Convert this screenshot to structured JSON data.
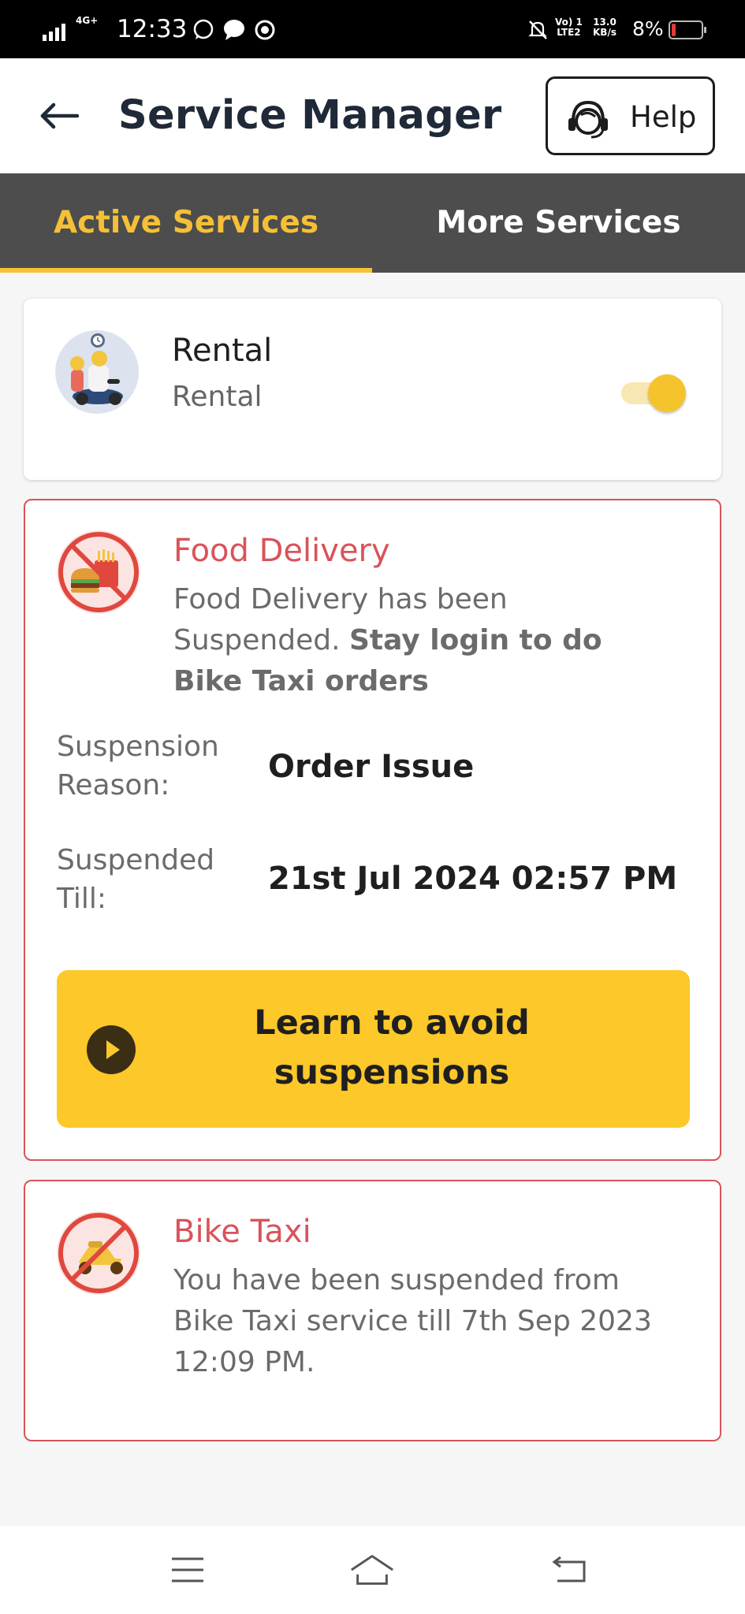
{
  "status_bar": {
    "network": "4G+",
    "time": "12:33",
    "volte": "Vo) 1",
    "lte": "LTE2",
    "speed_value": "13.0",
    "speed_unit": "KB/s",
    "battery": "8%",
    "battery_level": 0.08
  },
  "header": {
    "title": "Service Manager",
    "help_label": "Help"
  },
  "tabs": [
    {
      "label": "Active Services",
      "active": true
    },
    {
      "label": "More Services",
      "active": false
    }
  ],
  "services": {
    "rental": {
      "title": "Rental",
      "subtitle": "Rental",
      "enabled": true
    },
    "food_delivery": {
      "title": "Food Delivery",
      "desc_plain": "Food Delivery has been Suspended. ",
      "desc_bold": "Stay login to do Bike Taxi orders",
      "reason_label": "Suspension Reason:",
      "reason_value": "Order Issue",
      "till_label": "Suspended Till:",
      "till_value": "21st Jul 2024 02:57 PM",
      "learn_label": "Learn to avoid suspensions"
    },
    "bike_taxi": {
      "title": "Bike Taxi",
      "description": "You have been suspended from Bike Taxi service till 7th Sep 2023 12:09 PM."
    }
  },
  "colors": {
    "accent": "#f5c035",
    "tab_bar": "#4d4d4d",
    "suspended": "#d9535a",
    "cta": "#fdc829"
  },
  "icons": {
    "back": "arrow-left-icon",
    "help": "headset-icon",
    "play": "play-icon",
    "nav_menu": "menu-icon",
    "nav_home": "home-icon",
    "nav_back": "back-icon"
  }
}
